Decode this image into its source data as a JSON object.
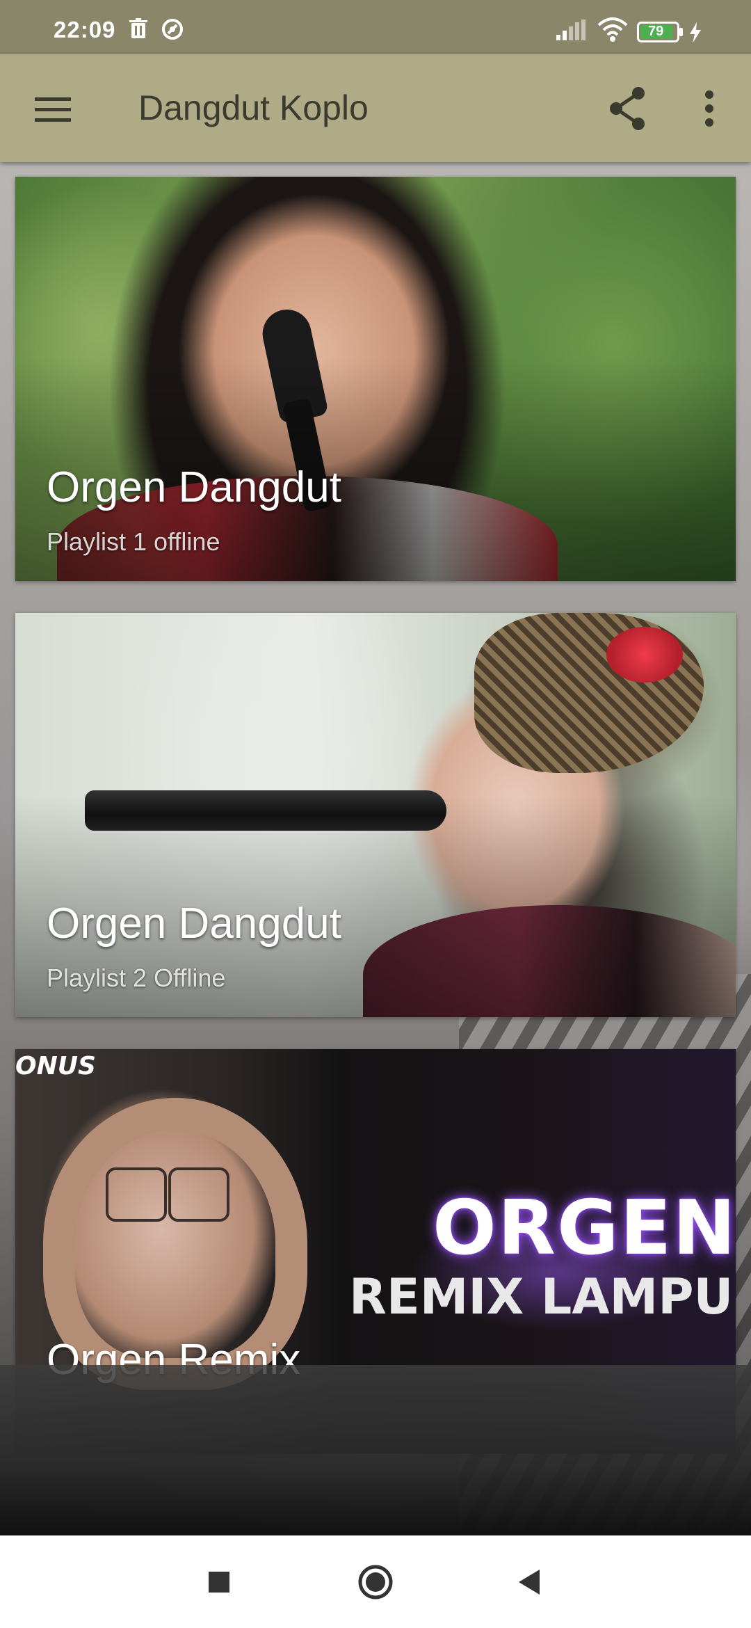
{
  "status_bar": {
    "time": "22:09",
    "battery_level": "79",
    "icons": [
      "trash-icon",
      "vpn-icon",
      "signal-icon",
      "wifi-icon",
      "battery-icon",
      "charging-icon"
    ]
  },
  "app_bar": {
    "title": "Dangdut Koplo",
    "icons": [
      "menu-icon",
      "share-icon",
      "more-vert-icon"
    ]
  },
  "cards": [
    {
      "title": "Orgen Dangdut",
      "subtitle": "Playlist 1 offline"
    },
    {
      "title": "Orgen Dangdut",
      "subtitle": "Playlist 2 Offline"
    },
    {
      "title": "Orgen Remix",
      "art_text_top": "ONUS",
      "art_text_big": "ORGEN",
      "art_text_small": "REMIX LAMPUN"
    }
  ],
  "nav_bar": {
    "icons": [
      "recents-square-icon",
      "home-circle-icon",
      "back-triangle-icon"
    ]
  },
  "colors": {
    "status_bar": "#8a866a",
    "app_bar": "#b0ab87",
    "title_text": "#3a3a2f",
    "nav_bar": "#ffffff"
  }
}
